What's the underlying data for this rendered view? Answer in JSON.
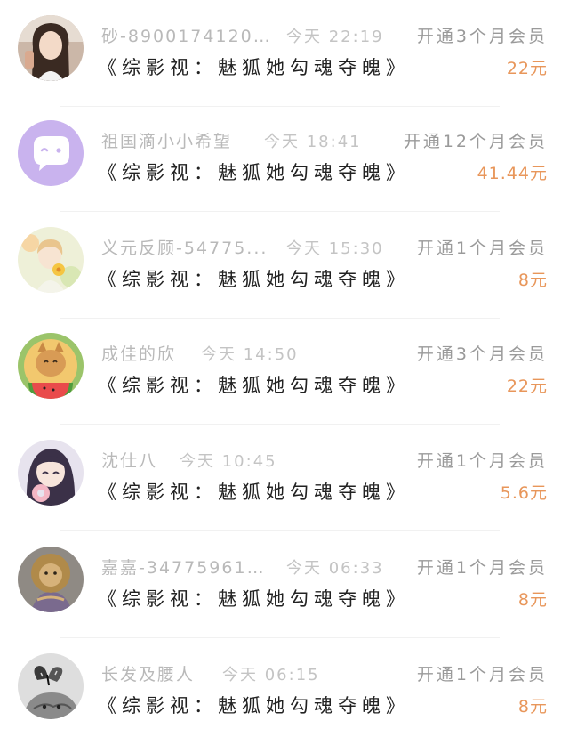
{
  "orders": [
    {
      "avatar_icon": "girl-photo-avatar-icon",
      "username": "砂-89001741205...",
      "time": "今天 22:19",
      "plan": "开通3个月会员",
      "work": "《综影视：魅狐她勾魂夺魄》",
      "price": "22元"
    },
    {
      "avatar_icon": "chat-bubble-avatar-icon",
      "username": "祖国滴小小希望",
      "time": "今天 18:41",
      "plan": "开通12个月会员",
      "work": "《综影视：魅狐她勾魂夺魄》",
      "price": "41.44元"
    },
    {
      "avatar_icon": "flower-girl-avatar-icon",
      "username": "义元反顾-54775...",
      "time": "今天 15:30",
      "plan": "开通1个月会员",
      "work": "《综影视：魅狐她勾魂夺魄》",
      "price": "8元"
    },
    {
      "avatar_icon": "cat-watermelon-avatar-icon",
      "username": "成佳的欣",
      "time": "今天 14:50",
      "plan": "开通3个月会员",
      "work": "《综影视：魅狐她勾魂夺魄》",
      "price": "22元"
    },
    {
      "avatar_icon": "anime-girl-avatar-icon",
      "username": "沈仕八",
      "time": "今天 10:45",
      "plan": "开通1个月会员",
      "work": "《综影视：魅狐她勾魂夺魄》",
      "price": "5.6元"
    },
    {
      "avatar_icon": "lion-avatar-icon",
      "username": "嘉嘉-347759611...",
      "time": "今天 06:33",
      "plan": "开通1个月会员",
      "work": "《综影视：魅狐她勾魂夺魄》",
      "price": "8元"
    },
    {
      "avatar_icon": "butterfly-cat-avatar-icon",
      "username": "长发及腰人",
      "time": "今天 06:15",
      "plan": "开通1个月会员",
      "work": "《综影视：魅狐她勾魂夺魄》",
      "price": "8元"
    }
  ]
}
